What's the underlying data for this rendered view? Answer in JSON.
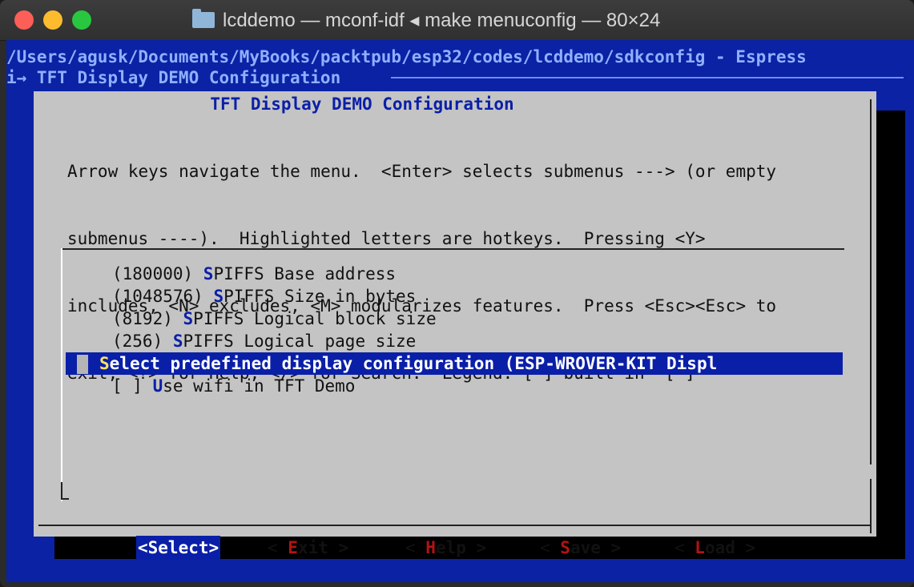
{
  "window": {
    "title": "lcddemo — mconf-idf ◂ make menuconfig — 80×24"
  },
  "terminal": {
    "path": "/Users/agusk/Documents/MyBooks/packtpub/esp32/codes/lcddemo/sdkconfig - Espress",
    "breadcrumb": "i→ TFT Display DEMO Configuration"
  },
  "dialog": {
    "title": "TFT Display DEMO Configuration",
    "help_lines": [
      "Arrow keys navigate the menu.  <Enter> selects submenus ---> (or empty",
      "submenus ----).  Highlighted letters are hotkeys.  Pressing <Y>",
      "includes, <N> excludes, <M> modularizes features.  Press <Esc><Esc> to",
      "exit, <?> for Help, </> for Search.  Legend: [*] built-in  [ ]"
    ],
    "menu": [
      {
        "prefix": "(180000) ",
        "hotkey": "S",
        "rest": "PIFFS Base address"
      },
      {
        "prefix": "(1048576) ",
        "hotkey": "S",
        "rest": "PIFFS Size in bytes"
      },
      {
        "prefix": "(8192) ",
        "hotkey": "S",
        "rest": "PIFFS Logical block size"
      },
      {
        "prefix": "(256) ",
        "hotkey": "S",
        "rest": "PIFFS Logical page size"
      },
      {
        "prefix": "",
        "hotkey": "S",
        "rest": "elect predefined display configuration (ESP-WROVER-KIT Displ"
      },
      {
        "prefix": "[ ] ",
        "hotkey": "U",
        "rest": "se wifi in TFT Demo"
      }
    ],
    "buttons": {
      "select": "<Select>",
      "exit_open": "< ",
      "exit_hot": "E",
      "exit_rest": "xit >",
      "help_open": "< ",
      "help_hot": "H",
      "help_rest": "elp >",
      "save_open": "< ",
      "save_hot": "S",
      "save_rest": "ave >",
      "load_open": "< ",
      "load_hot": "L",
      "load_rest": "oad >"
    }
  },
  "colors": {
    "terminal_bg": "#0a22a3",
    "dialog_bg": "#c4c4c4",
    "highlight": "#0a1fa8",
    "hotkey_button": "#b31313"
  }
}
